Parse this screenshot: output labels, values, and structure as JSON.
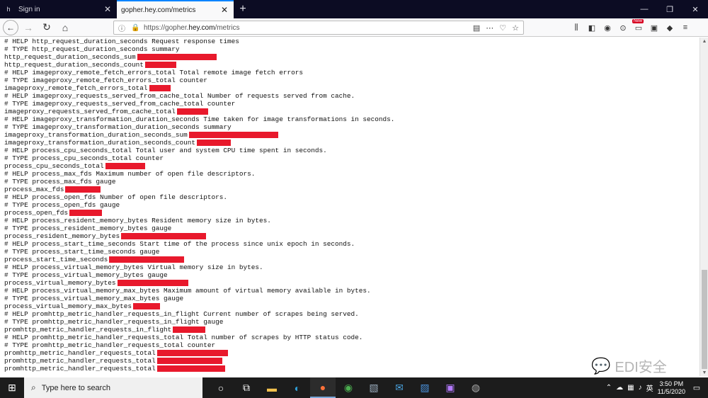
{
  "tabs": [
    {
      "label": "Sign in",
      "favicon": "h",
      "active": false
    },
    {
      "label": "gopher.hey.com/metrics",
      "favicon": "",
      "active": true
    }
  ],
  "window_controls": [
    "—",
    "❐",
    "✕"
  ],
  "urlbar": {
    "prefix": "https://gopher.",
    "domain": "hey.com",
    "suffix": "/metrics"
  },
  "metrics_lines": [
    {
      "text": "# HELP http_request_duration_seconds Request response times",
      "redact": 0
    },
    {
      "text": "# TYPE http_request_duration_seconds summary",
      "redact": 0
    },
    {
      "text": "http_request_duration_seconds_sum",
      "redact": 112
    },
    {
      "text": "http_request_duration_seconds_count",
      "redact": 44
    },
    {
      "text": "# HELP imageproxy_remote_fetch_errors_total Total remote image fetch errors",
      "redact": 0
    },
    {
      "text": "# TYPE imageproxy_remote_fetch_errors_total counter",
      "redact": 0
    },
    {
      "text": "imageproxy_remote_fetch_errors_total",
      "redact": 30
    },
    {
      "text": "# HELP imageproxy_requests_served_from_cache_total Number of requests served from cache.",
      "redact": 0
    },
    {
      "text": "# TYPE imageproxy_requests_served_from_cache_total counter",
      "redact": 0
    },
    {
      "text": "imageproxy_requests_served_from_cache_total",
      "redact": 44
    },
    {
      "text": "# HELP imageproxy_transformation_duration_seconds Time taken for image transformations in seconds.",
      "redact": 0
    },
    {
      "text": "# TYPE imageproxy_transformation_duration_seconds summary",
      "redact": 0
    },
    {
      "text": "imageproxy_transformation_duration_seconds_sum",
      "redact": 126
    },
    {
      "text": "imageproxy_transformation_duration_seconds_count",
      "redact": 48
    },
    {
      "text": "# HELP process_cpu_seconds_total Total user and system CPU time spent in seconds.",
      "redact": 0
    },
    {
      "text": "# TYPE process_cpu_seconds_total counter",
      "redact": 0
    },
    {
      "text": "process_cpu_seconds_total",
      "redact": 56
    },
    {
      "text": "# HELP process_max_fds Maximum number of open file descriptors.",
      "redact": 0
    },
    {
      "text": "# TYPE process_max_fds gauge",
      "redact": 0
    },
    {
      "text": "process_max_fds",
      "redact": 50
    },
    {
      "text": "# HELP process_open_fds Number of open file descriptors.",
      "redact": 0
    },
    {
      "text": "# TYPE process_open_fds gauge",
      "redact": 0
    },
    {
      "text": "process_open_fds",
      "redact": 46
    },
    {
      "text": "# HELP process_resident_memory_bytes Resident memory size in bytes.",
      "redact": 0
    },
    {
      "text": "# TYPE process_resident_memory_bytes gauge",
      "redact": 0
    },
    {
      "text": "process_resident_memory_bytes",
      "redact": 120
    },
    {
      "text": "# HELP process_start_time_seconds Start time of the process since unix epoch in seconds.",
      "redact": 0
    },
    {
      "text": "# TYPE process_start_time_seconds gauge",
      "redact": 0
    },
    {
      "text": "process_start_time_seconds",
      "redact": 106
    },
    {
      "text": "# HELP process_virtual_memory_bytes Virtual memory size in bytes.",
      "redact": 0
    },
    {
      "text": "# TYPE process_virtual_memory_bytes gauge",
      "redact": 0
    },
    {
      "text": "process_virtual_memory_bytes",
      "redact": 100
    },
    {
      "text": "# HELP process_virtual_memory_max_bytes Maximum amount of virtual memory available in bytes.",
      "redact": 0
    },
    {
      "text": "# TYPE process_virtual_memory_max_bytes gauge",
      "redact": 0
    },
    {
      "text": "process_virtual_memory_max_bytes",
      "redact": 38
    },
    {
      "text": "# HELP promhttp_metric_handler_requests_in_flight Current number of scrapes being served.",
      "redact": 0
    },
    {
      "text": "# TYPE promhttp_metric_handler_requests_in_flight gauge",
      "redact": 0
    },
    {
      "text": "promhttp_metric_handler_requests_in_flight",
      "redact": 46
    },
    {
      "text": "# HELP promhttp_metric_handler_requests_total Total number of scrapes by HTTP status code.",
      "redact": 0
    },
    {
      "text": "# TYPE promhttp_metric_handler_requests_total counter",
      "redact": 0
    },
    {
      "text": "promhttp_metric_handler_requests_total",
      "redact": 100
    },
    {
      "text": "promhttp_metric_handler_requests_total",
      "redact": 92
    },
    {
      "text": "promhttp_metric_handler_requests_total",
      "redact": 96
    }
  ],
  "watermark": {
    "text": "EDI安全"
  },
  "taskbar": {
    "search_placeholder": "Type here to search",
    "time": "3:50 PM",
    "date": "11/5/2020"
  },
  "colors": {
    "redaction": "#e8192c",
    "tabstrip": "#0c0c23",
    "taskbar": "#1c1c1c"
  }
}
